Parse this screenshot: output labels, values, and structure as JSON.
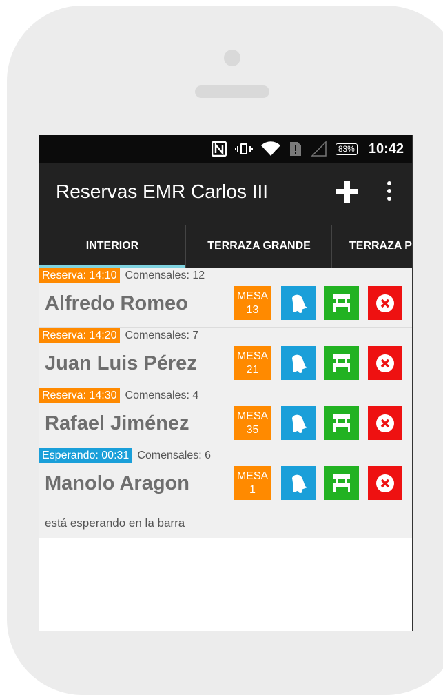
{
  "status_bar": {
    "icons": [
      "nfc-icon",
      "vibrate-icon",
      "wifi-icon",
      "sim-icon",
      "signal-icon"
    ],
    "battery": "83%",
    "time": "10:42"
  },
  "app_bar": {
    "title": "Reservas EMR Carlos III",
    "actions": [
      "add-icon",
      "overflow-menu-icon"
    ]
  },
  "tabs": [
    {
      "label": "INTERIOR",
      "selected": true
    },
    {
      "label": "TERRAZA GRANDE",
      "selected": false
    },
    {
      "label": "TERRAZA P",
      "selected": false
    }
  ],
  "reservations": [
    {
      "status": "Reserva: 14:10",
      "status_color": "#ff8a00",
      "guests": "Comensales: 12",
      "name": "Alfredo Romeo",
      "mesa_label": "MESA",
      "mesa_number": "13"
    },
    {
      "status": "Reserva: 14:20",
      "status_color": "#ff8a00",
      "guests": "Comensales: 7",
      "name": "Juan Luis Pérez",
      "mesa_label": "MESA",
      "mesa_number": "21"
    },
    {
      "status": "Reserva: 14:30",
      "status_color": "#ff8a00",
      "guests": "Comensales: 4",
      "name": "Rafael Jiménez",
      "mesa_label": "MESA",
      "mesa_number": "35"
    },
    {
      "status": "Esperando: 00:31",
      "status_color": "#1a9fd9",
      "guests": "Comensales: 6",
      "name": "Manolo Aragon",
      "mesa_label": "MESA",
      "mesa_number": "1",
      "note": "está esperando en la barra"
    }
  ],
  "colors": {
    "accent_orange": "#ff8a00",
    "accent_blue": "#1a9fd9",
    "seat_green": "#22b222",
    "cancel_red": "#ee1111",
    "app_bar": "#222222"
  }
}
